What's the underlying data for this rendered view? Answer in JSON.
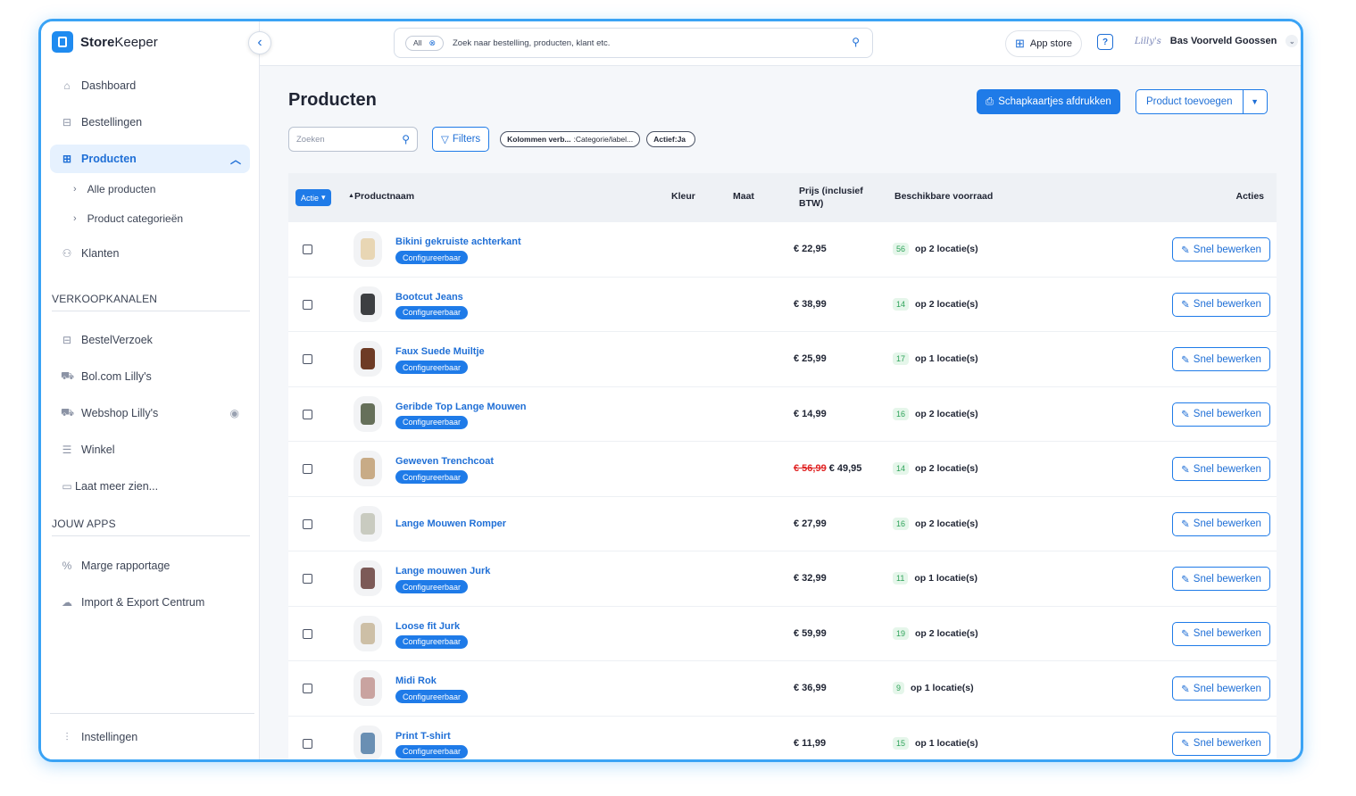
{
  "app": {
    "name_bold": "Store",
    "name_rest": "Keeper"
  },
  "sidebar": {
    "items": [
      {
        "label": "Dashboard",
        "icon": "home-icon"
      },
      {
        "label": "Bestellingen",
        "icon": "orders-icon"
      },
      {
        "label": "Producten",
        "icon": "products-icon",
        "active": true
      },
      {
        "label": "Klanten",
        "icon": "customers-icon"
      }
    ],
    "sub_items": [
      "Alle producten",
      "Product categorieën"
    ],
    "section_sales": "VERKOOPKANALEN",
    "sales_items": [
      {
        "label": "BestelVerzoek",
        "icon": "basket-icon"
      },
      {
        "label": "Bol.com Lilly's",
        "icon": "cart-icon"
      },
      {
        "label": "Webshop Lilly's",
        "icon": "cart-icon"
      },
      {
        "label": "Winkel",
        "icon": "store-icon"
      },
      {
        "label": "Laat meer zien...",
        "icon": "folder-icon"
      }
    ],
    "section_apps": "JOUW APPS",
    "app_items": [
      {
        "label": "Marge rapportage",
        "icon": "percent-icon"
      },
      {
        "label": "Import & Export Centrum",
        "icon": "cloud-icon"
      }
    ],
    "settings": "Instellingen"
  },
  "topbar": {
    "search_scope": "All",
    "search_placeholder": "Zoek naar bestelling, producten, klant etc.",
    "app_store": "App store",
    "shop_logo": "Lilly's",
    "user_name": "Bas Voorveld Goossen"
  },
  "page": {
    "title": "Producten",
    "print_button": "Schapkaartjes afdrukken",
    "add_button": "Product toevoegen",
    "search_placeholder": "Zoeken",
    "filters_button": "Filters",
    "chip_columns_key": "Kolommen verb...",
    "chip_columns_val": ":Categorie/label...",
    "chip_active": "Actief:Ja"
  },
  "table": {
    "action_button": "Actie",
    "headers": {
      "name": "Productnaam",
      "color": "Kleur",
      "size": "Maat",
      "price_1": "Prijs (inclusief",
      "price_2": "BTW)",
      "stock": "Beschikbare voorraad",
      "actions": "Acties"
    },
    "configurable_label": "Configureerbaar",
    "edit_label": "Snel bewerken",
    "rows": [
      {
        "name": "Bikini gekruiste achterkant",
        "configurable": true,
        "price": "€ 22,95",
        "old_price": "",
        "stock": "56",
        "locations": "op 2 locatie(s)",
        "thumb_color": "#e8d6b4"
      },
      {
        "name": "Bootcut Jeans",
        "configurable": true,
        "price": "€ 38,99",
        "old_price": "",
        "stock": "14",
        "locations": "op 2 locatie(s)",
        "thumb_color": "#3d3f42"
      },
      {
        "name": "Faux Suede Muiltje",
        "configurable": true,
        "price": "€ 25,99",
        "old_price": "",
        "stock": "17",
        "locations": "op 1 locatie(s)",
        "thumb_color": "#6e3b25"
      },
      {
        "name": "Geribde Top Lange Mouwen",
        "configurable": true,
        "price": "€ 14,99",
        "old_price": "",
        "stock": "16",
        "locations": "op 2 locatie(s)",
        "thumb_color": "#66705a"
      },
      {
        "name": "Geweven Trenchcoat",
        "configurable": true,
        "price": "€ 49,95",
        "old_price": "€ 56,99",
        "stock": "14",
        "locations": "op 2 locatie(s)",
        "thumb_color": "#c8ab86"
      },
      {
        "name": "Lange Mouwen Romper",
        "configurable": false,
        "price": "€ 27,99",
        "old_price": "",
        "stock": "16",
        "locations": "op 2 locatie(s)",
        "thumb_color": "#c9cbc0"
      },
      {
        "name": "Lange mouwen Jurk",
        "configurable": true,
        "price": "€ 32,99",
        "old_price": "",
        "stock": "11",
        "locations": "op 1 locatie(s)",
        "thumb_color": "#7c5a57"
      },
      {
        "name": "Loose fit Jurk",
        "configurable": true,
        "price": "€ 59,99",
        "old_price": "",
        "stock": "19",
        "locations": "op 2 locatie(s)",
        "thumb_color": "#cdbfa6"
      },
      {
        "name": "Midi Rok",
        "configurable": true,
        "price": "€ 36,99",
        "old_price": "",
        "stock": "9",
        "locations": "op 1 locatie(s)",
        "thumb_color": "#c9a3a0"
      },
      {
        "name": "Print T-shirt",
        "configurable": true,
        "price": "€ 11,99",
        "old_price": "",
        "stock": "15",
        "locations": "op 1 locatie(s)",
        "thumb_color": "#6a8fb3"
      }
    ]
  },
  "colors": {
    "accent": "#1f7be8",
    "frame": "#3aa3f5",
    "sale": "#e02424",
    "stock_green": "#2ea35a"
  }
}
